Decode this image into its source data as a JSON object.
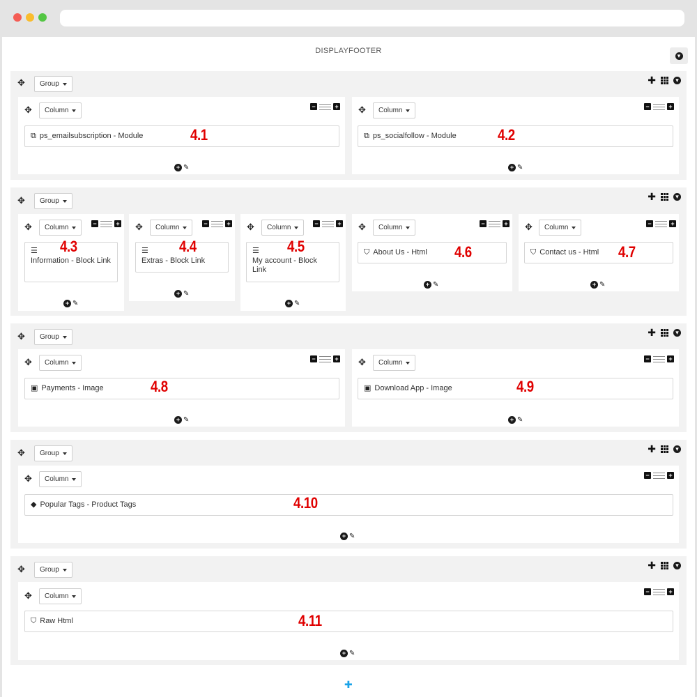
{
  "browser": {
    "url": ""
  },
  "hook": {
    "title": "DISPLAYFOOTER"
  },
  "labels": {
    "group": "Group",
    "column": "Column"
  },
  "groups": [
    {
      "columns": [
        {
          "module": "ps_emailsubscription - Module",
          "icon": "module-icon",
          "annotation": "4.1"
        },
        {
          "module": "ps_socialfollow - Module",
          "icon": "module-icon",
          "annotation": "4.2"
        }
      ]
    },
    {
      "columns": [
        {
          "module": "Information - Block Link",
          "icon": "list-icon",
          "annotation": "4.3"
        },
        {
          "module": "Extras - Block Link",
          "icon": "list-icon",
          "annotation": "4.4"
        },
        {
          "module": "My account - Block Link",
          "icon": "list-icon",
          "annotation": "4.5"
        },
        {
          "module": "About Us - Html",
          "icon": "html5-icon",
          "annotation": "4.6"
        },
        {
          "module": "Contact us - Html",
          "icon": "html5-icon",
          "annotation": "4.7"
        }
      ]
    },
    {
      "columns": [
        {
          "module": "Payments - Image",
          "icon": "image-icon",
          "annotation": "4.8"
        },
        {
          "module": "Download App - Image",
          "icon": "image-icon",
          "annotation": "4.9"
        }
      ]
    },
    {
      "columns": [
        {
          "module": "Popular Tags - Product Tags",
          "icon": "tags-icon",
          "annotation": "4.10"
        }
      ]
    },
    {
      "columns": [
        {
          "module": "Raw Html",
          "icon": "html5-icon",
          "annotation": "4.11"
        }
      ]
    }
  ],
  "colors": {
    "annotation": "#e00000",
    "add_group": "#1aa3e8",
    "group_bg": "#f2f2f2"
  }
}
